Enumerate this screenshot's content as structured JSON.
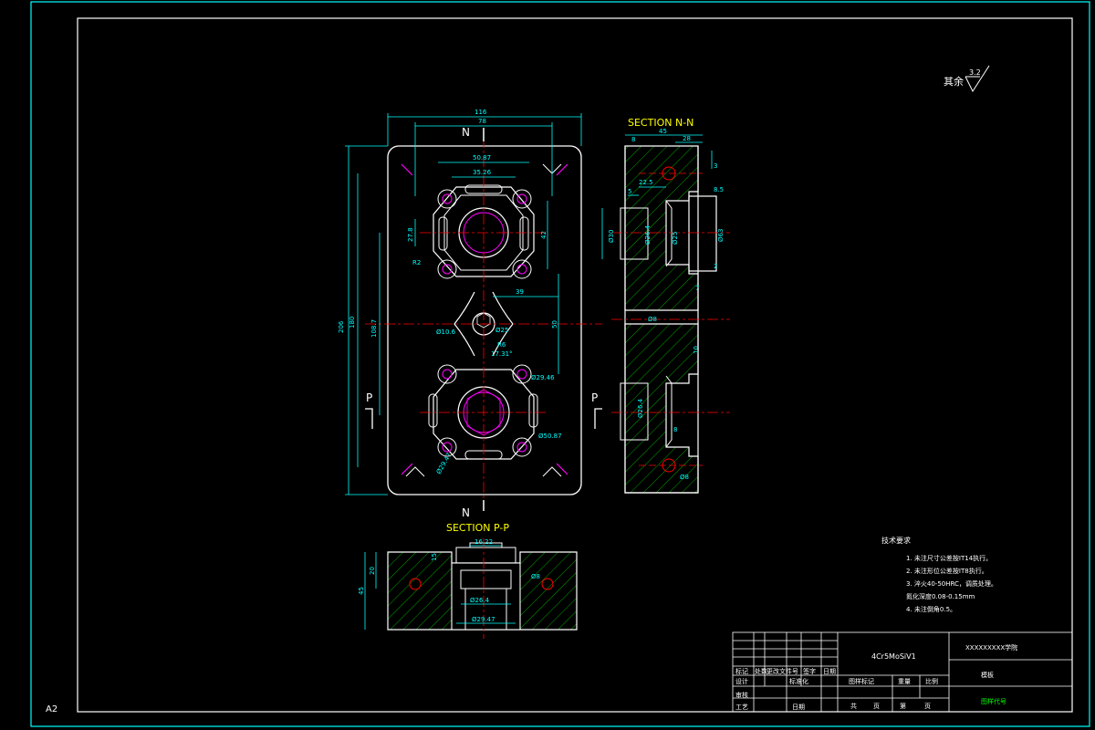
{
  "sheet": {
    "size_label": "A2",
    "roughness": {
      "prefix": "其余",
      "value": "3.2"
    },
    "colors": {
      "background": "#000000",
      "outline": "#ffffff",
      "dimension": "#00ffff",
      "center_line": "#ff0000",
      "hatch": "#00ff00",
      "section_label": "#ffff00",
      "detail": "#ff00ff"
    }
  },
  "views": {
    "front": {
      "section_mark_top": "N",
      "section_mark_bottom": "N",
      "section_mark_left": "P",
      "section_mark_right": "P",
      "dims": {
        "top_overall": "116",
        "top_inner": "78",
        "top_mid": "50.87",
        "top_small": "35.26",
        "left_overall": "206",
        "left_mid": "180",
        "left_inner": "108.7",
        "left_small": "27.8",
        "left_r": "R2",
        "right_v": "42",
        "right_a": "39",
        "right_b": "50",
        "hole_a": "Ø10.6",
        "hole_b": "Ø25",
        "angle": "17.31°",
        "dia_a": "Ø29.46",
        "dia_b": "Ø50.87",
        "dia_c": "Ø29.47",
        "r_small": "R6"
      }
    },
    "section_nn": {
      "title": "SECTION N-N",
      "dims": {
        "top_a": "45",
        "top_b": "28",
        "top_c": "8",
        "right_a": "3",
        "right_b": "8.5",
        "right_c": "7",
        "right_d": "2",
        "mid_a": "22.5",
        "mid_b": "5",
        "dia_a": "Ø30",
        "dia_b": "Ø26.4",
        "dia_c": "Ø63",
        "dia_d": "Ø25",
        "dia_e": "Ø26.4",
        "dia_f": "Ø8",
        "dia_g": "Ø8",
        "small_a": "10",
        "small_b": "8"
      }
    },
    "section_pp": {
      "title": "SECTION P-P",
      "dims": {
        "top": "16.22",
        "left_a": "45",
        "left_b": "20",
        "left_c": "15",
        "dia_a": "Ø26.4",
        "dia_b": "Ø29.47",
        "small": "Ø8"
      }
    }
  },
  "notes": {
    "title": "技术要求",
    "items": [
      "1. 未注尺寸公差按IT14执行。",
      "2. 未注形位公差按IT8执行。",
      "3. 淬火40-50HRC，调质处理。",
      "氮化深度0.08-0.15mm",
      "4. 未注倒角0.5。"
    ]
  },
  "title_block": {
    "material": "4Cr5MoSiV1",
    "school": "XXXXXXXXX学院",
    "part_name": "模板",
    "drawing_no": "图样代号",
    "headers_row1": [
      "标记",
      "处数",
      "更改文件号",
      "签字",
      "日期"
    ],
    "headers_row2": [
      "设计",
      "",
      "标准化",
      "",
      ""
    ],
    "headers_row3": [
      "审核",
      "",
      "",
      "",
      ""
    ],
    "headers_row4": [
      "工艺",
      "",
      "日期",
      "",
      ""
    ],
    "stage_cols": [
      "图样标记",
      "重量",
      "比例"
    ],
    "sheet_cols": [
      "共",
      "页",
      "第",
      "页"
    ]
  }
}
